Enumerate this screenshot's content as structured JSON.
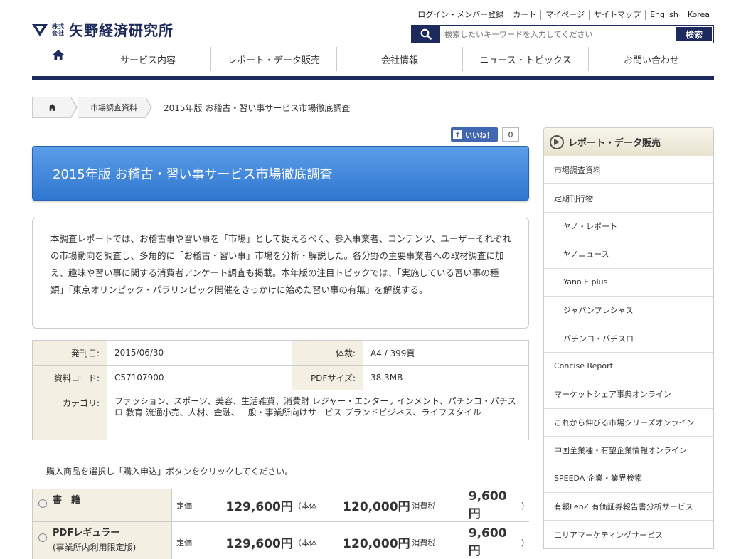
{
  "header": {
    "logo_kaisha_top": "株式",
    "logo_kaisha_bottom": "会社",
    "logo_name": "矢野経済研究所",
    "top_links": [
      "ログイン・メンバー登録",
      "カート",
      "マイページ",
      "サイトマップ",
      "English",
      "Korea"
    ],
    "search_placeholder": "検索したいキーワードを入力してください",
    "search_button": "検索"
  },
  "nav": {
    "items": [
      "サービス内容",
      "レポート・データ販売",
      "会社情報",
      "ニュース・トピックス",
      "お問い合わせ"
    ]
  },
  "breadcrumb": {
    "level1": "市場調査資料",
    "current": "2015年版 お稽古・習い事サービス市場徹底調査"
  },
  "fb": {
    "label": "いいね！",
    "count": "0"
  },
  "title": "2015年版 お稽古・習い事サービス市場徹底調査",
  "description": "本調査レポートでは、お稽古事や習い事を「市場」として捉えるべく、参入事業者、コンテンツ、ユーザーそれぞれの市場動向を調査し、多角的に「お稽古・習い事」市場を分析・解説した。各分野の主要事業者への取材調査に加え、趣味や習い事に関する消費者アンケート調査も掲載。本年版の注目トピックでは、「実施している習い事の種類」「東京オリンピック・パラリンピック開催をきっかけに始めた習い事の有無」を解説する。",
  "info": {
    "publish_label": "発刊日:",
    "publish_value": "2015/06/30",
    "format_label": "体裁:",
    "format_value": "A4 / 399頁",
    "code_label": "資料コード:",
    "code_value": "C57107900",
    "pdf_label": "PDFサイズ:",
    "pdf_value": "38.3MB",
    "category_label": "カテゴリ:",
    "category_value": "ファッション、スポーツ、美容、生活雑貨、消費財 レジャー・エンターテインメント、パチンコ・パチスロ 教育 流通小売、人材、金融、一般・事業所向けサービス ブランドビジネス、ライフスタイル"
  },
  "instruction": "購入商品を選択し「購入申込」ボタンをクリックしてください。",
  "products": [
    {
      "name": "書　籍",
      "note": "",
      "price_label": "定価",
      "price": "129,600円",
      "base_label": "（本体",
      "base": "120,000円",
      "tax_label": "消費税",
      "tax": "9,600円",
      "close": "）"
    },
    {
      "name": "PDFレギュラー",
      "note": "(事業所内利用限定版)",
      "price_label": "定価",
      "price": "129,600円",
      "base_label": "（本体",
      "base": "120,000円",
      "tax_label": "消費税",
      "tax": "9,600円",
      "close": "）"
    }
  ],
  "sidebar": {
    "title": "レポート・データ販売",
    "items": [
      {
        "label": "市場調査資料",
        "sub": false
      },
      {
        "label": "定期刊行物",
        "sub": false
      },
      {
        "label": "ヤノ・レポート",
        "sub": true
      },
      {
        "label": "ヤノニュース",
        "sub": true
      },
      {
        "label": "Yano E plus",
        "sub": true
      },
      {
        "label": "ジャパンプレシャス",
        "sub": true
      },
      {
        "label": "パチンコ・パチスロ",
        "sub": true
      },
      {
        "label": "Concise Report",
        "sub": false
      },
      {
        "label": "マーケットシェア事典オンライン",
        "sub": false
      },
      {
        "label": "これから伸びる市場シリーズオンライン",
        "sub": false
      },
      {
        "label": "中国全業種・有望企業情報オンライン",
        "sub": false
      },
      {
        "label": "SPEEDA 企業・業界検索",
        "sub": false
      },
      {
        "label": "有報LenZ 有価証券報告書分析サービス",
        "sub": false
      },
      {
        "label": "エリアマーケティングサービス",
        "sub": false
      }
    ]
  },
  "colors": {
    "navy": "#1d2a5e",
    "banner_blue": "#2f76cf",
    "label_bg": "#f3efe3"
  }
}
